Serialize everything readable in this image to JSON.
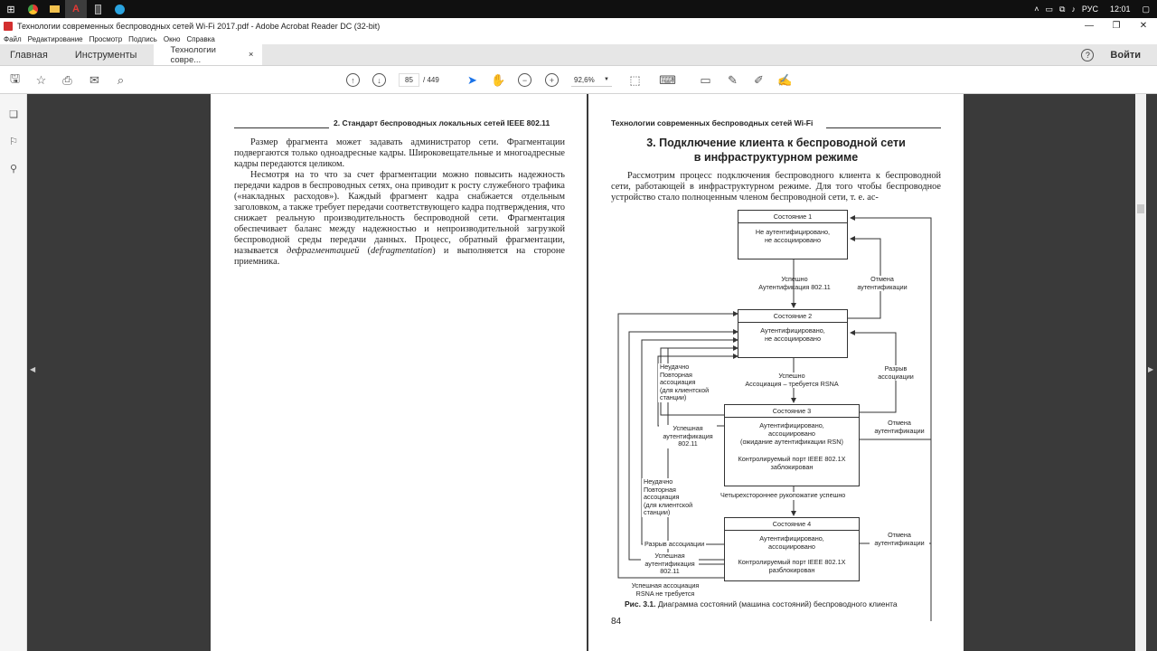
{
  "taskbar": {
    "tray_lang": "РУС",
    "tray_time": "12:01"
  },
  "window": {
    "title": "Технологии современных беспроводных сетей Wi-Fi  2017.pdf - Adobe Acrobat Reader DC (32-bit)"
  },
  "menu": [
    "Файл",
    "Редактирование",
    "Просмотр",
    "Подпись",
    "Окно",
    "Справка"
  ],
  "tabs": {
    "home": "Главная",
    "tools": "Инструменты",
    "doc": "Технологии совре...",
    "close": "×",
    "signin": "Войти",
    "help": "?"
  },
  "toolbar": {
    "page_current": "85",
    "page_total": "/  449",
    "zoom": "92,6%"
  },
  "left_page": {
    "header": "2. Стандарт беспроводных локальных сетей IEEE 802.11",
    "p1": "Размер фрагмента может задавать администратор сети. Фрагментации подвергаются только одноадресные кадры. Широковещательные и многоадресные кадры передаются целиком.",
    "p2_start": "Несмотря на то что за счет фрагментации можно повысить надежность передачи кадров в беспроводных сетях, она приводит к росту служебного трафика («накладных расходов»). Каждый фрагмент кадра снабжается отдельным заголовком, а также требует передачи соответствующего кадра подтверждения, что снижает реальную производительность беспроводной сети. Фрагментация обеспечивает баланс между надежностью и непроизводительной загрузкой беспроводной среды передачи данных. Процесс, обратный фрагментации, называется ",
    "p2_em1": "дефрагментацией",
    "p2_mid": " (",
    "p2_em2": "defragmentation",
    "p2_end": ") и выполняется на стороне приемника."
  },
  "right_page": {
    "header": "Технологии современных беспроводных сетей Wi-Fi",
    "title_line1": "3. Подключение клиента к беспроводной сети",
    "title_line2": "в инфраструктурном режиме",
    "intro": "Рассмотрим процесс подключения беспроводного клиента к беспроводной сети, работающей в инфраструктурном режиме. Для того чтобы беспроводное устройство стало полноценным членом беспроводной сети, т. е. ас-",
    "caption_bold": "Рис. 3.1.",
    "caption": " Диаграмма состояний (машина состояний) беспроводного клиента",
    "page_number": "84"
  },
  "diagram": {
    "s1_title": "Состояние 1",
    "s1_l1": "Не аутентифицировано,",
    "s1_l2": "не ассоциировано",
    "s2_title": "Состояние 2",
    "s2_l1": "Аутентифицировано,",
    "s2_l2": "не ассоциировано",
    "s3_title": "Состояние 3",
    "s3_l1": "Аутентифицировано,",
    "s3_l2": "ассоциировано",
    "s3_l3": "(ожидание аутентификации RSN)",
    "s3_l4": "Контролируемый порт IEEE 802.1X",
    "s3_l5": "заблокирован",
    "s4_title": "Состояние 4",
    "s4_l1": "Аутентифицировано,",
    "s4_l2": "ассоциировано",
    "s4_l3": "Контролируемый порт IEEE 802.1X",
    "s4_l4": "разблокирован",
    "t_auth_ok_1": "Успешно",
    "t_auth_ok_2": "Аутентификация 802.11",
    "t_deauth1_1": "Отмена",
    "t_deauth1_2": "аутентификации",
    "t_assoc_ok_1": "Успешно",
    "t_assoc_ok_2": "Ассоциация – требуется RSNA",
    "t_disassoc1_1": "Разрыв",
    "t_disassoc1_2": "ассоциации",
    "t_fail1_1": "Неудачно",
    "t_fail1_2": "Повторная",
    "t_fail1_3": "ассоциация",
    "t_fail1_4": "(для клиентской",
    "t_fail1_5": "станции)",
    "t_authok3_1": "Успешная",
    "t_authok3_2": "аутентификация",
    "t_authok3_3": "802.11",
    "t_deauth3_1": "Отмена",
    "t_deauth3_2": "аутентификации",
    "t_4way": "Четырехстороннее рукопожатие успешно",
    "t_fail2_1": "Неудачно",
    "t_fail2_2": "Повторная",
    "t_fail2_3": "ассоциация",
    "t_fail2_4": "(для клиентской",
    "t_fail2_5": "станции)",
    "t_disassoc2": "Разрыв ассоциации",
    "t_authok4_1": "Успешная",
    "t_authok4_2": "аутентификация",
    "t_authok4_3": "802.11",
    "t_deauth4_1": "Отмена",
    "t_deauth4_2": "аутентификации",
    "t_assoc_norsna_1": "Успешная ассоциация",
    "t_assoc_norsna_2": "RSNA не требуется"
  }
}
